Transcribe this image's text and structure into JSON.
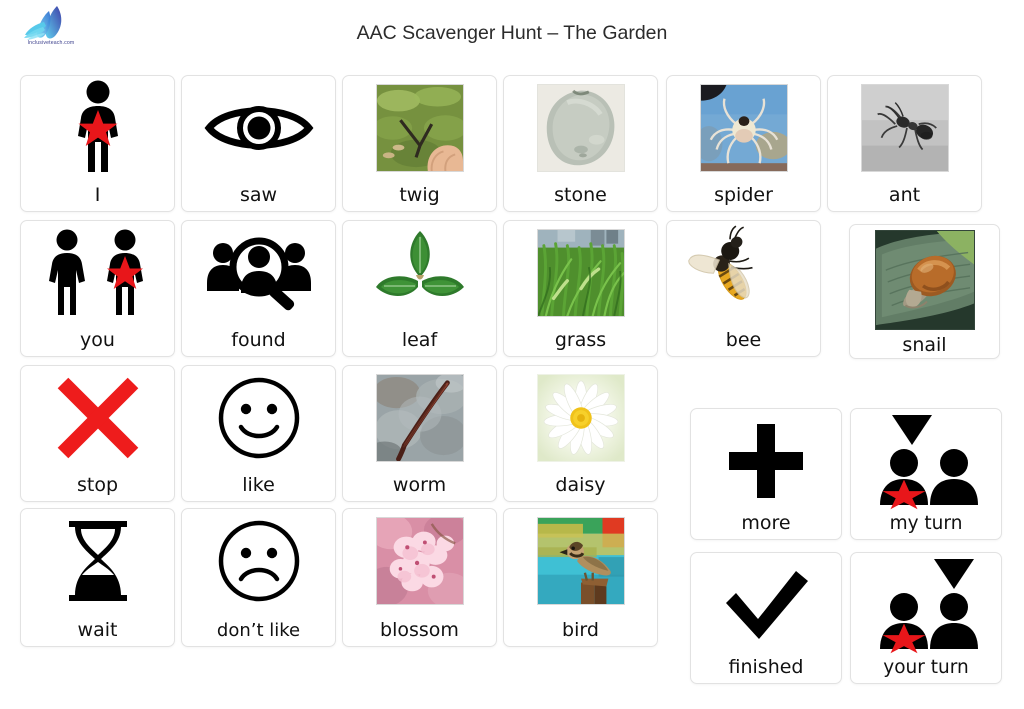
{
  "header": {
    "title": "AAC Scavenger Hunt – The Garden",
    "logo_brand": "Inclusiveteach.com",
    "logo_icon": "feather-leaf-logo-icon"
  },
  "colors": {
    "background": "#ffffff",
    "card_border": "#e2e2e2",
    "text": "#111111",
    "title_text": "#2b2b2b",
    "accent_red": "#e8161a",
    "brand_blue": "#3b3f8c",
    "symbol_black": "#000000"
  },
  "grid": {
    "columns": 6,
    "rows": 4,
    "cards": [
      {
        "label": "I",
        "icon": "person-with-red-star-icon",
        "kind": "symbol",
        "row": 1,
        "col": 1
      },
      {
        "label": "saw",
        "icon": "eye-icon",
        "kind": "symbol",
        "row": 1,
        "col": 2
      },
      {
        "label": "twig",
        "icon": "twig-photo",
        "kind": "photo",
        "row": 1,
        "col": 3
      },
      {
        "label": "stone",
        "icon": "stone-photo",
        "kind": "photo",
        "row": 1,
        "col": 4
      },
      {
        "label": "spider",
        "icon": "spider-photo",
        "kind": "photo",
        "row": 1,
        "col": 5
      },
      {
        "label": "ant",
        "icon": "ant-photo",
        "kind": "photo",
        "row": 1,
        "col": 6
      },
      {
        "label": "you",
        "icon": "two-people-second-with-red-star-icon",
        "kind": "symbol",
        "row": 2,
        "col": 1
      },
      {
        "label": "found",
        "icon": "people-with-magnifier-icon",
        "kind": "symbol",
        "row": 2,
        "col": 2
      },
      {
        "label": "leaf",
        "icon": "three-green-leaves-photo",
        "kind": "photo",
        "row": 2,
        "col": 3
      },
      {
        "label": "grass",
        "icon": "grass-photo",
        "kind": "photo",
        "row": 2,
        "col": 4
      },
      {
        "label": "bee",
        "icon": "bee-photo",
        "kind": "photo",
        "row": 2,
        "col": 5
      },
      {
        "label": "snail",
        "icon": "snail-on-leaf-photo",
        "kind": "photo",
        "row": 2,
        "col": 6
      },
      {
        "label": "stop",
        "icon": "red-cross-icon",
        "kind": "symbol",
        "row": 3,
        "col": 1
      },
      {
        "label": "like",
        "icon": "smiley-face-icon",
        "kind": "symbol",
        "row": 3,
        "col": 2
      },
      {
        "label": "worm",
        "icon": "worm-photo",
        "kind": "photo",
        "row": 3,
        "col": 3
      },
      {
        "label": "daisy",
        "icon": "daisy-photo",
        "kind": "photo",
        "row": 3,
        "col": 4
      },
      {
        "label": "wait",
        "icon": "hourglass-icon",
        "kind": "symbol",
        "row": 4,
        "col": 1
      },
      {
        "label": "don’t like",
        "icon": "sad-face-icon",
        "kind": "symbol",
        "row": 4,
        "col": 2
      },
      {
        "label": "blossom",
        "icon": "pink-blossom-photo",
        "kind": "photo",
        "row": 4,
        "col": 3
      },
      {
        "label": "bird",
        "icon": "bird-photo",
        "kind": "photo",
        "row": 4,
        "col": 4
      }
    ]
  },
  "side_panel": {
    "cards": [
      {
        "label": "more",
        "icon": "plus-icon",
        "row": 1,
        "col": 1
      },
      {
        "label": "my turn",
        "icon": "two-busts-triangle-over-left-icon",
        "row": 1,
        "col": 2
      },
      {
        "label": "finished",
        "icon": "checkmark-icon",
        "row": 2,
        "col": 1
      },
      {
        "label": "your turn",
        "icon": "two-busts-triangle-over-right-icon",
        "row": 2,
        "col": 2
      }
    ]
  }
}
